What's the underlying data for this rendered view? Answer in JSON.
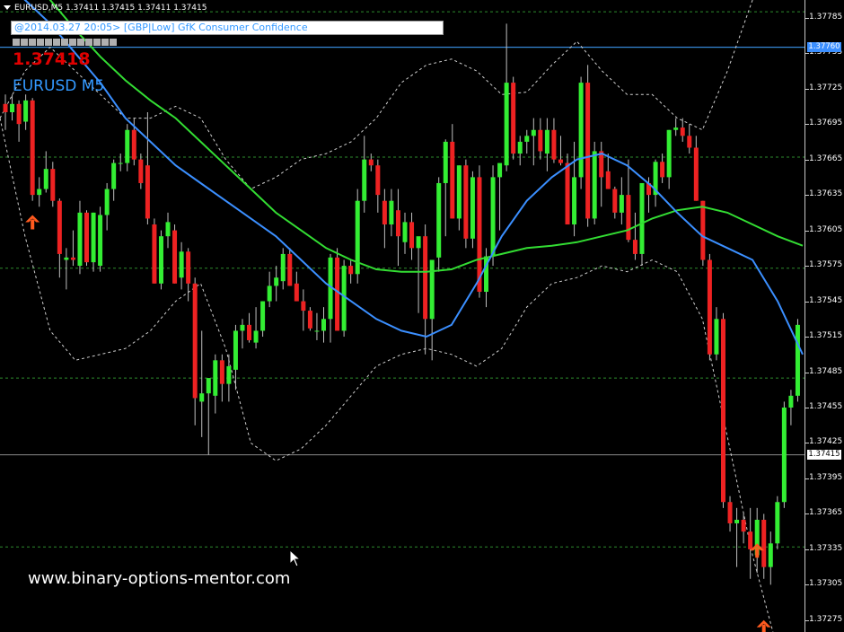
{
  "header": {
    "symbol_line": "EURUSD,M5  1.37411 1.37415 1.37411 1.37415"
  },
  "news_box": {
    "text": "@2014.03.27 20:05> [GBP|Low] GfK Consumer Confidence"
  },
  "bid_price": "1.37418",
  "symbol_label": "EURUSD M5",
  "watermark": "www.binary-options-mentor.com",
  "colors": {
    "bull": "#33ee33",
    "bear": "#ee2222",
    "ma_fast": "#3b8fff",
    "ma_slow": "#33dd33",
    "band": "#cfcfcf",
    "level": "#2e8b2e",
    "arrow": "#ff5a1f"
  },
  "chart_data": {
    "type": "candlestick",
    "symbol": "EURUSD",
    "timeframe": "M5",
    "ylim": [
      1.37265,
      1.378
    ],
    "yticks": [
      "1.37785",
      "1.37755",
      "1.37725",
      "1.37695",
      "1.37665",
      "1.37635",
      "1.37605",
      "1.37575",
      "1.37545",
      "1.37515",
      "1.37485",
      "1.37455",
      "1.37425",
      "1.37395",
      "1.37365",
      "1.37335",
      "1.37305",
      "1.37275"
    ],
    "current_price_labels": [
      "1.37760",
      "1.37415"
    ],
    "current_price_values": [
      1.3776,
      1.37415
    ],
    "level_lines": [
      1.3779,
      1.3776,
      1.37667,
      1.37573,
      1.3748,
      1.37337
    ],
    "candles": [
      [
        1.37712,
        1.3772,
        1.3769,
        1.37705
      ],
      [
        1.37705,
        1.3772,
        1.37698,
        1.37712
      ],
      [
        1.37712,
        1.37715,
        1.3768,
        1.37695
      ],
      [
        1.37697,
        1.3772,
        1.3769,
        1.37715
      ],
      [
        1.37715,
        1.37717,
        1.3763,
        1.37635
      ],
      [
        1.37635,
        1.3765,
        1.37625,
        1.3764
      ],
      [
        1.3764,
        1.37672,
        1.37637,
        1.37657
      ],
      [
        1.37657,
        1.37663,
        1.37625,
        1.3763
      ],
      [
        1.3763,
        1.37632,
        1.37565,
        1.37585
      ],
      [
        1.3758,
        1.3759,
        1.37555,
        1.37582
      ],
      [
        1.37582,
        1.37605,
        1.37575,
        1.3758
      ],
      [
        1.37575,
        1.3763,
        1.37568,
        1.3762
      ],
      [
        1.3762,
        1.37622,
        1.37575,
        1.37578
      ],
      [
        1.37578,
        1.3762,
        1.3757,
        1.3762
      ],
      [
        1.37575,
        1.37625,
        1.3757,
        1.37618
      ],
      [
        1.37618,
        1.37645,
        1.37605,
        1.3764
      ],
      [
        1.3764,
        1.37665,
        1.3763,
        1.37662
      ],
      [
        1.37662,
        1.3767,
        1.37655,
        1.37662
      ],
      [
        1.37662,
        1.37695,
        1.37655,
        1.3769
      ],
      [
        1.3769,
        1.377,
        1.3766,
        1.37665
      ],
      [
        1.37665,
        1.3767,
        1.3764,
        1.37645
      ],
      [
        1.3766,
        1.37705,
        1.3761,
        1.37615
      ],
      [
        1.3761,
        1.37615,
        1.3756,
        1.3756
      ],
      [
        1.3756,
        1.37605,
        1.37555,
        1.376
      ],
      [
        1.376,
        1.3762,
        1.3759,
        1.37612
      ],
      [
        1.37605,
        1.3761,
        1.3756,
        1.3756
      ],
      [
        1.37565,
        1.37595,
        1.37555,
        1.37587
      ],
      [
        1.37587,
        1.3759,
        1.37545,
        1.3756
      ],
      [
        1.3756,
        1.37565,
        1.3744,
        1.37463
      ],
      [
        1.3746,
        1.3752,
        1.3743,
        1.37467
      ],
      [
        1.37467,
        1.3747,
        1.37415,
        1.3748
      ],
      [
        1.37465,
        1.375,
        1.3745,
        1.37495
      ],
      [
        1.37495,
        1.375,
        1.3746,
        1.37475
      ],
      [
        1.37475,
        1.375,
        1.3746,
        1.3749
      ],
      [
        1.37487,
        1.37525,
        1.3747,
        1.3752
      ],
      [
        1.3752,
        1.3753,
        1.37505,
        1.37525
      ],
      [
        1.37525,
        1.37535,
        1.3751,
        1.37512
      ],
      [
        1.3751,
        1.3754,
        1.37505,
        1.3752
      ],
      [
        1.3752,
        1.37545,
        1.37515,
        1.37545
      ],
      [
        1.37545,
        1.3757,
        1.3754,
        1.37558
      ],
      [
        1.37558,
        1.37575,
        1.37545,
        1.37565
      ],
      [
        1.37562,
        1.3759,
        1.37555,
        1.37585
      ],
      [
        1.37585,
        1.3759,
        1.37558,
        1.37558
      ],
      [
        1.3756,
        1.3757,
        1.37545,
        1.37545
      ],
      [
        1.37545,
        1.37555,
        1.3752,
        1.37537
      ],
      [
        1.37537,
        1.3754,
        1.3752,
        1.37522
      ],
      [
        1.3752,
        1.37535,
        1.37512,
        1.3752
      ],
      [
        1.3752,
        1.3754,
        1.3751,
        1.3753
      ],
      [
        1.3753,
        1.37585,
        1.3751,
        1.37582
      ],
      [
        1.37582,
        1.3759,
        1.3752,
        1.3752
      ],
      [
        1.3752,
        1.3758,
        1.37515,
        1.37575
      ],
      [
        1.37575,
        1.3758,
        1.3756,
        1.37568
      ],
      [
        1.37568,
        1.3764,
        1.3756,
        1.3763
      ],
      [
        1.3763,
        1.37685,
        1.3762,
        1.37665
      ],
      [
        1.37665,
        1.3767,
        1.37655,
        1.3766
      ],
      [
        1.3766,
        1.37665,
        1.3762,
        1.37635
      ],
      [
        1.3763,
        1.3764,
        1.3759,
        1.3761
      ],
      [
        1.3761,
        1.3764,
        1.376,
        1.3763
      ],
      [
        1.37622,
        1.3764,
        1.37575,
        1.376
      ],
      [
        1.37595,
        1.3762,
        1.37585,
        1.37612
      ],
      [
        1.37612,
        1.3762,
        1.3758,
        1.3759
      ],
      [
        1.3759,
        1.37595,
        1.37535,
        1.376
      ],
      [
        1.376,
        1.3761,
        1.375,
        1.3753
      ],
      [
        1.3753,
        1.3756,
        1.37495,
        1.3758
      ],
      [
        1.37582,
        1.3765,
        1.3757,
        1.37645
      ],
      [
        1.37645,
        1.37682,
        1.376,
        1.3768
      ],
      [
        1.3768,
        1.37695,
        1.37615,
        1.37615
      ],
      [
        1.37615,
        1.3766,
        1.37605,
        1.3766
      ],
      [
        1.3766,
        1.37665,
        1.3759,
        1.37598
      ],
      [
        1.37598,
        1.37655,
        1.3759,
        1.3765
      ],
      [
        1.3765,
        1.3766,
        1.37548,
        1.37553
      ],
      [
        1.37553,
        1.3759,
        1.3754,
        1.37583
      ],
      [
        1.37583,
        1.3766,
        1.37575,
        1.3765
      ],
      [
        1.3765,
        1.3766,
        1.37605,
        1.37662
      ],
      [
        1.3766,
        1.3778,
        1.37655,
        1.3773
      ],
      [
        1.3773,
        1.37735,
        1.37665,
        1.3767
      ],
      [
        1.3767,
        1.37685,
        1.3766,
        1.3768
      ],
      [
        1.3768,
        1.3769,
        1.3767,
        1.37685
      ],
      [
        1.37685,
        1.377,
        1.3766,
        1.3769
      ],
      [
        1.3769,
        1.377,
        1.37665,
        1.37672
      ],
      [
        1.3767,
        1.377,
        1.37655,
        1.3769
      ],
      [
        1.3769,
        1.377,
        1.37662,
        1.37665
      ],
      [
        1.37665,
        1.37685,
        1.3766,
        1.37662
      ],
      [
        1.37662,
        1.3767,
        1.3762,
        1.3761
      ],
      [
        1.3761,
        1.3768,
        1.376,
        1.3765
      ],
      [
        1.3765,
        1.37735,
        1.3764,
        1.3773
      ],
      [
        1.3773,
        1.37745,
        1.37608,
        1.37615
      ],
      [
        1.37615,
        1.3768,
        1.3761,
        1.37672
      ],
      [
        1.37672,
        1.3768,
        1.37625,
        1.3765
      ],
      [
        1.37655,
        1.3767,
        1.3764,
        1.3764
      ],
      [
        1.3764,
        1.37642,
        1.37615,
        1.3762
      ],
      [
        1.3762,
        1.3765,
        1.3761,
        1.37635
      ],
      [
        1.37635,
        1.37665,
        1.37595,
        1.37597
      ],
      [
        1.37597,
        1.3762,
        1.3758,
        1.37585
      ],
      [
        1.37585,
        1.3764,
        1.37575,
        1.37645
      ],
      [
        1.37645,
        1.3765,
        1.3762,
        1.37635
      ],
      [
        1.37635,
        1.37665,
        1.37625,
        1.37663
      ],
      [
        1.37663,
        1.3767,
        1.37645,
        1.3765
      ],
      [
        1.3765,
        1.3769,
        1.3764,
        1.3769
      ],
      [
        1.3769,
        1.377,
        1.37685,
        1.37692
      ],
      [
        1.37692,
        1.377,
        1.3768,
        1.37685
      ],
      [
        1.37685,
        1.37695,
        1.3767,
        1.37675
      ],
      [
        1.37675,
        1.37685,
        1.3763,
        1.3763
      ],
      [
        1.3763,
        1.3763,
        1.37575,
        1.3758
      ],
      [
        1.3758,
        1.37585,
        1.37495,
        1.375
      ],
      [
        1.375,
        1.3754,
        1.37495,
        1.3753
      ],
      [
        1.3753,
        1.37535,
        1.3737,
        1.37375
      ],
      [
        1.37375,
        1.3738,
        1.3735,
        1.37357
      ],
      [
        1.37357,
        1.3737,
        1.3732,
        1.3736
      ],
      [
        1.3736,
        1.37365,
        1.3734,
        1.3735
      ],
      [
        1.3735,
        1.3737,
        1.3731,
        1.37335
      ],
      [
        1.3733,
        1.3737,
        1.37315,
        1.3736
      ],
      [
        1.3736,
        1.37365,
        1.3731,
        1.3732
      ],
      [
        1.3732,
        1.3735,
        1.37305,
        1.3734
      ],
      [
        1.3734,
        1.3738,
        1.37335,
        1.37375
      ],
      [
        1.37375,
        1.3746,
        1.3737,
        1.37455
      ],
      [
        1.37455,
        1.3747,
        1.3744,
        1.37465
      ],
      [
        1.37465,
        1.3753,
        1.3746,
        1.37525
      ]
    ],
    "ma_fast": [
      1.3782,
      1.378,
      1.3778,
      1.37755,
      1.3773,
      1.377,
      1.3768,
      1.3766,
      1.37645,
      1.3763,
      1.37615,
      1.376,
      1.3758,
      1.3756,
      1.37545,
      1.3753,
      1.3752,
      1.37515,
      1.37525,
      1.3756,
      1.376,
      1.3763,
      1.3765,
      1.37665,
      1.3767,
      1.3766,
      1.37642,
      1.3762,
      1.376,
      1.3759,
      1.3758,
      1.37545,
      1.375
    ],
    "ma_slow": [
      1.3785,
      1.3783,
      1.378,
      1.37775,
      1.37752,
      1.37732,
      1.37715,
      1.377,
      1.3768,
      1.3766,
      1.3764,
      1.3762,
      1.37605,
      1.3759,
      1.3758,
      1.37572,
      1.3757,
      1.3757,
      1.37572,
      1.3758,
      1.37585,
      1.3759,
      1.37592,
      1.37595,
      1.376,
      1.37605,
      1.37615,
      1.37622,
      1.37625,
      1.3762,
      1.3761,
      1.376,
      1.37592
    ],
    "bb_upper": [
      1.377,
      1.3774,
      1.3776,
      1.3774,
      1.3772,
      1.377,
      1.377,
      1.3771,
      1.377,
      1.37665,
      1.3764,
      1.3765,
      1.37665,
      1.3767,
      1.3768,
      1.377,
      1.3773,
      1.37745,
      1.3775,
      1.3774,
      1.3772,
      1.37722,
      1.37745,
      1.37765,
      1.3774,
      1.3772,
      1.3772,
      1.377,
      1.3769,
      1.3774,
      1.378,
      1.37845,
      1.3783
    ],
    "bb_lower": [
      1.377,
      1.376,
      1.3752,
      1.37495,
      1.375,
      1.37505,
      1.3752,
      1.37545,
      1.3756,
      1.37505,
      1.37425,
      1.3741,
      1.3742,
      1.3744,
      1.37465,
      1.3749,
      1.375,
      1.37505,
      1.375,
      1.3749,
      1.37505,
      1.3754,
      1.3756,
      1.37565,
      1.37575,
      1.3757,
      1.3758,
      1.3757,
      1.3753,
      1.3743,
      1.3733,
      1.3725,
      1.3724
    ],
    "arrows": [
      {
        "candle": 4,
        "price": 1.37618
      },
      {
        "candle": 111,
        "price": 1.3734
      },
      {
        "candle": 112,
        "price": 1.37275
      }
    ]
  },
  "icons": {
    "menu": "triangle-down-icon",
    "cursor": "cursor-arrow-icon",
    "signal": "up-arrow-icon"
  }
}
